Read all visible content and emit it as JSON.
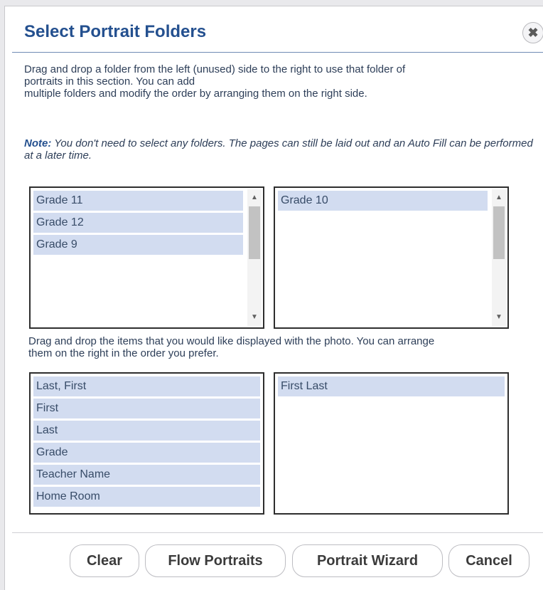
{
  "dialog": {
    "title": "Select Portrait Folders",
    "close_icon": "close-icon"
  },
  "instructions": {
    "line1": "Drag and drop a folder from the left (unused) side to the right to use that folder of",
    "line2": "portraits in this section. You can add",
    "line3": "multiple folders and modify the order by arranging them on the right side."
  },
  "note": {
    "label": "Note:",
    "text": " You don't need to select any folders. The pages can still be laid out and an Auto Fill can be performed at a later time."
  },
  "folders": {
    "unused": [
      "Grade 11",
      "Grade 12",
      "Grade 9"
    ],
    "used": [
      "Grade 10"
    ]
  },
  "fields_instructions": {
    "line1": "Drag and drop the items that you would like displayed with the photo. You can arrange",
    "line2": "them on the right in the order you prefer."
  },
  "fields": {
    "available": [
      "Last, First",
      "First",
      "Last",
      "Grade",
      "Teacher Name",
      "Home Room"
    ],
    "selected": [
      "First Last"
    ]
  },
  "buttons": {
    "clear": "Clear",
    "flow_portraits": "Flow Portraits",
    "portrait_wizard": "Portrait Wizard",
    "cancel": "Cancel"
  },
  "colors": {
    "title": "#24508f",
    "item_background": "#d2dcf0"
  }
}
